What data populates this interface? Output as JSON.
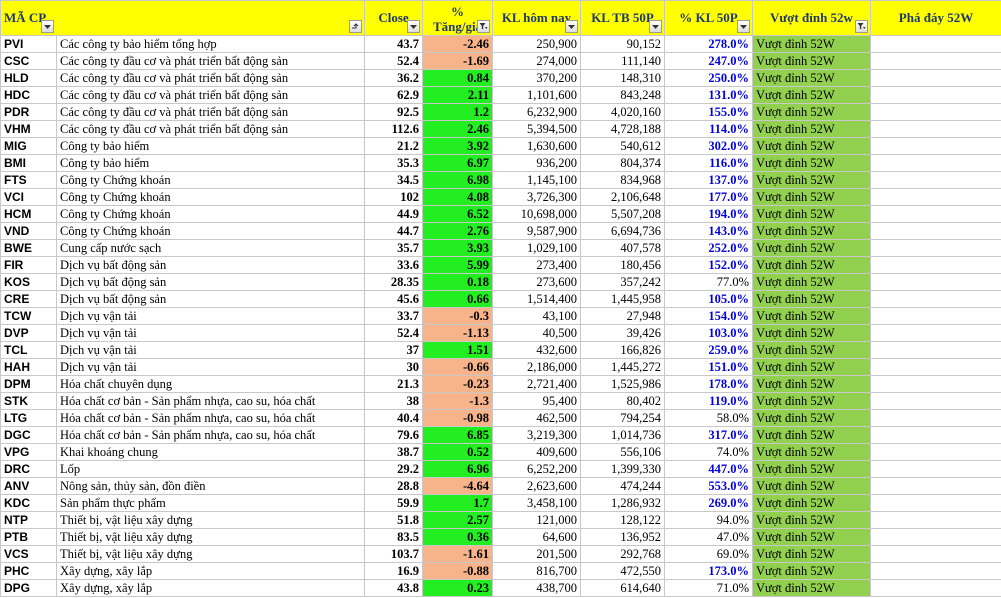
{
  "headers": {
    "code": "MÃ CP",
    "close": "Close",
    "change_line1": "%",
    "change_line2": "Tăng/giả",
    "volume_today": "KL hôm nay",
    "volume_avg50": "KL TB 50P",
    "volume_pct50": "% KL 50P",
    "high52": "Vượt đỉnh 52w",
    "low52": "Phá đáy 52W"
  },
  "colors": {
    "header_bg": "#ffff00",
    "header_text": "#1f3864",
    "change_up_bg": "#22ee22",
    "change_down_bg": "#f7b38a",
    "high52_bg": "#92d050",
    "pct_high_text": "#0000e0"
  },
  "icons": {
    "filter": "filter-dropdown-icon",
    "filter_active": "filter-active-icon"
  },
  "rows": [
    {
      "code": "PVI",
      "sector": "Các công ty bảo hiểm tổng hợp",
      "close": "43.7",
      "change": "-2.46",
      "vol": "250,900",
      "avg": "90,152",
      "pct": "278.0%",
      "high": "Vượt đỉnh 52W",
      "low": ""
    },
    {
      "code": "CSC",
      "sector": "Các công ty đầu cơ và phát triển bất động sản",
      "close": "52.4",
      "change": "-1.69",
      "vol": "274,000",
      "avg": "111,140",
      "pct": "247.0%",
      "high": "Vượt đỉnh 52W",
      "low": ""
    },
    {
      "code": "HLD",
      "sector": "Các công ty đầu cơ và phát triển bất động sản",
      "close": "36.2",
      "change": "0.84",
      "vol": "370,200",
      "avg": "148,310",
      "pct": "250.0%",
      "high": "Vượt đỉnh 52W",
      "low": ""
    },
    {
      "code": "HDC",
      "sector": "Các công ty đầu cơ và phát triển bất động sản",
      "close": "62.9",
      "change": "2.11",
      "vol": "1,101,600",
      "avg": "843,248",
      "pct": "131.0%",
      "high": "Vượt đỉnh 52W",
      "low": ""
    },
    {
      "code": "PDR",
      "sector": "Các công ty đầu cơ và phát triển bất động sản",
      "close": "92.5",
      "change": "1.2",
      "vol": "6,232,900",
      "avg": "4,020,160",
      "pct": "155.0%",
      "high": "Vượt đỉnh 52W",
      "low": ""
    },
    {
      "code": "VHM",
      "sector": "Các công ty đầu cơ và phát triển bất động sản",
      "close": "112.6",
      "change": "2.46",
      "vol": "5,394,500",
      "avg": "4,728,188",
      "pct": "114.0%",
      "high": "Vượt đỉnh 52W",
      "low": ""
    },
    {
      "code": "MIG",
      "sector": "Công ty bảo hiểm",
      "close": "21.2",
      "change": "3.92",
      "vol": "1,630,600",
      "avg": "540,612",
      "pct": "302.0%",
      "high": "Vượt đỉnh 52W",
      "low": ""
    },
    {
      "code": "BMI",
      "sector": "Công ty bảo hiểm",
      "close": "35.3",
      "change": "6.97",
      "vol": "936,200",
      "avg": "804,374",
      "pct": "116.0%",
      "high": "Vượt đỉnh 52W",
      "low": ""
    },
    {
      "code": "FTS",
      "sector": "Công ty Chứng khoán",
      "close": "34.5",
      "change": "6.98",
      "vol": "1,145,100",
      "avg": "834,968",
      "pct": "137.0%",
      "high": "Vượt đỉnh 52W",
      "low": ""
    },
    {
      "code": "VCI",
      "sector": "Công ty Chứng khoán",
      "close": "102",
      "change": "4.08",
      "vol": "3,726,300",
      "avg": "2,106,648",
      "pct": "177.0%",
      "high": "Vượt đỉnh 52W",
      "low": ""
    },
    {
      "code": "HCM",
      "sector": "Công ty Chứng khoán",
      "close": "44.9",
      "change": "6.52",
      "vol": "10,698,000",
      "avg": "5,507,208",
      "pct": "194.0%",
      "high": "Vượt đỉnh 52W",
      "low": ""
    },
    {
      "code": "VND",
      "sector": "Công ty Chứng khoán",
      "close": "44.7",
      "change": "2.76",
      "vol": "9,587,900",
      "avg": "6,694,736",
      "pct": "143.0%",
      "high": "Vượt đỉnh 52W",
      "low": ""
    },
    {
      "code": "BWE",
      "sector": "Cung cấp nước sạch",
      "close": "35.7",
      "change": "3.93",
      "vol": "1,029,100",
      "avg": "407,578",
      "pct": "252.0%",
      "high": "Vượt đỉnh 52W",
      "low": ""
    },
    {
      "code": "FIR",
      "sector": "Dịch vụ bất động sản",
      "close": "33.6",
      "change": "5.99",
      "vol": "273,400",
      "avg": "180,456",
      "pct": "152.0%",
      "high": "Vượt đỉnh 52W",
      "low": ""
    },
    {
      "code": "KOS",
      "sector": "Dịch vụ bất động sản",
      "close": "28.35",
      "change": "0.18",
      "vol": "273,600",
      "avg": "357,242",
      "pct": "77.0%",
      "high": "Vượt đỉnh 52W",
      "low": ""
    },
    {
      "code": "CRE",
      "sector": "Dịch vụ bất động sản",
      "close": "45.6",
      "change": "0.66",
      "vol": "1,514,400",
      "avg": "1,445,958",
      "pct": "105.0%",
      "high": "Vượt đỉnh 52W",
      "low": ""
    },
    {
      "code": "TCW",
      "sector": "Dịch vụ vận tải",
      "close": "33.7",
      "change": "-0.3",
      "vol": "43,100",
      "avg": "27,948",
      "pct": "154.0%",
      "high": "Vượt đỉnh 52W",
      "low": ""
    },
    {
      "code": "DVP",
      "sector": "Dịch vụ vận tải",
      "close": "52.4",
      "change": "-1.13",
      "vol": "40,500",
      "avg": "39,426",
      "pct": "103.0%",
      "high": "Vượt đỉnh 52W",
      "low": ""
    },
    {
      "code": "TCL",
      "sector": "Dịch vụ vận tải",
      "close": "37",
      "change": "1.51",
      "vol": "432,600",
      "avg": "166,826",
      "pct": "259.0%",
      "high": "Vượt đỉnh 52W",
      "low": ""
    },
    {
      "code": "HAH",
      "sector": "Dịch vụ vận tải",
      "close": "30",
      "change": "-0.66",
      "vol": "2,186,000",
      "avg": "1,445,272",
      "pct": "151.0%",
      "high": "Vượt đỉnh 52W",
      "low": ""
    },
    {
      "code": "DPM",
      "sector": "Hóa chất chuyên dụng",
      "close": "21.3",
      "change": "-0.23",
      "vol": "2,721,400",
      "avg": "1,525,986",
      "pct": "178.0%",
      "high": "Vượt đỉnh 52W",
      "low": ""
    },
    {
      "code": "STK",
      "sector": "Hóa chất cơ bản - Sản phẩm nhựa, cao su, hóa chất",
      "close": "38",
      "change": "-1.3",
      "vol": "95,400",
      "avg": "80,402",
      "pct": "119.0%",
      "high": "Vượt đỉnh 52W",
      "low": ""
    },
    {
      "code": "LTG",
      "sector": "Hóa chất cơ bản - Sản phẩm nhựa, cao su, hóa chất",
      "close": "40.4",
      "change": "-0.98",
      "vol": "462,500",
      "avg": "794,254",
      "pct": "58.0%",
      "high": "Vượt đỉnh 52W",
      "low": ""
    },
    {
      "code": "DGC",
      "sector": "Hóa chất cơ bản - Sản phẩm nhựa, cao su, hóa chất",
      "close": "79.6",
      "change": "6.85",
      "vol": "3,219,300",
      "avg": "1,014,736",
      "pct": "317.0%",
      "high": "Vượt đỉnh 52W",
      "low": ""
    },
    {
      "code": "VPG",
      "sector": "Khai khoáng chung",
      "close": "38.7",
      "change": "0.52",
      "vol": "409,600",
      "avg": "556,106",
      "pct": "74.0%",
      "high": "Vượt đỉnh 52W",
      "low": ""
    },
    {
      "code": "DRC",
      "sector": "Lốp",
      "close": "29.2",
      "change": "6.96",
      "vol": "6,252,200",
      "avg": "1,399,330",
      "pct": "447.0%",
      "high": "Vượt đỉnh 52W",
      "low": ""
    },
    {
      "code": "ANV",
      "sector": "Nông sản, thủy sản, đồn điền",
      "close": "28.8",
      "change": "-4.64",
      "vol": "2,623,600",
      "avg": "474,244",
      "pct": "553.0%",
      "high": "Vượt đỉnh 52W",
      "low": ""
    },
    {
      "code": "KDC",
      "sector": "Sản phẩm thực phẩm",
      "close": "59.9",
      "change": "1.7",
      "vol": "3,458,100",
      "avg": "1,286,932",
      "pct": "269.0%",
      "high": "Vượt đỉnh 52W",
      "low": ""
    },
    {
      "code": "NTP",
      "sector": "Thiết bị, vật liệu xây dựng",
      "close": "51.8",
      "change": "2.57",
      "vol": "121,000",
      "avg": "128,122",
      "pct": "94.0%",
      "high": "Vượt đỉnh 52W",
      "low": ""
    },
    {
      "code": "PTB",
      "sector": "Thiết bị, vật liệu xây dựng",
      "close": "83.5",
      "change": "0.36",
      "vol": "64,600",
      "avg": "136,952",
      "pct": "47.0%",
      "high": "Vượt đỉnh 52W",
      "low": ""
    },
    {
      "code": "VCS",
      "sector": "Thiết bị, vật liệu xây dựng",
      "close": "103.7",
      "change": "-1.61",
      "vol": "201,500",
      "avg": "292,768",
      "pct": "69.0%",
      "high": "Vượt đỉnh 52W",
      "low": ""
    },
    {
      "code": "PHC",
      "sector": "Xây dựng, xây lắp",
      "close": "16.9",
      "change": "-0.88",
      "vol": "816,700",
      "avg": "472,550",
      "pct": "173.0%",
      "high": "Vượt đỉnh 52W",
      "low": ""
    },
    {
      "code": "DPG",
      "sector": "Xây dựng, xây lắp",
      "close": "43.8",
      "change": "0.23",
      "vol": "438,700",
      "avg": "614,640",
      "pct": "71.0%",
      "high": "Vượt đỉnh 52W",
      "low": ""
    }
  ]
}
